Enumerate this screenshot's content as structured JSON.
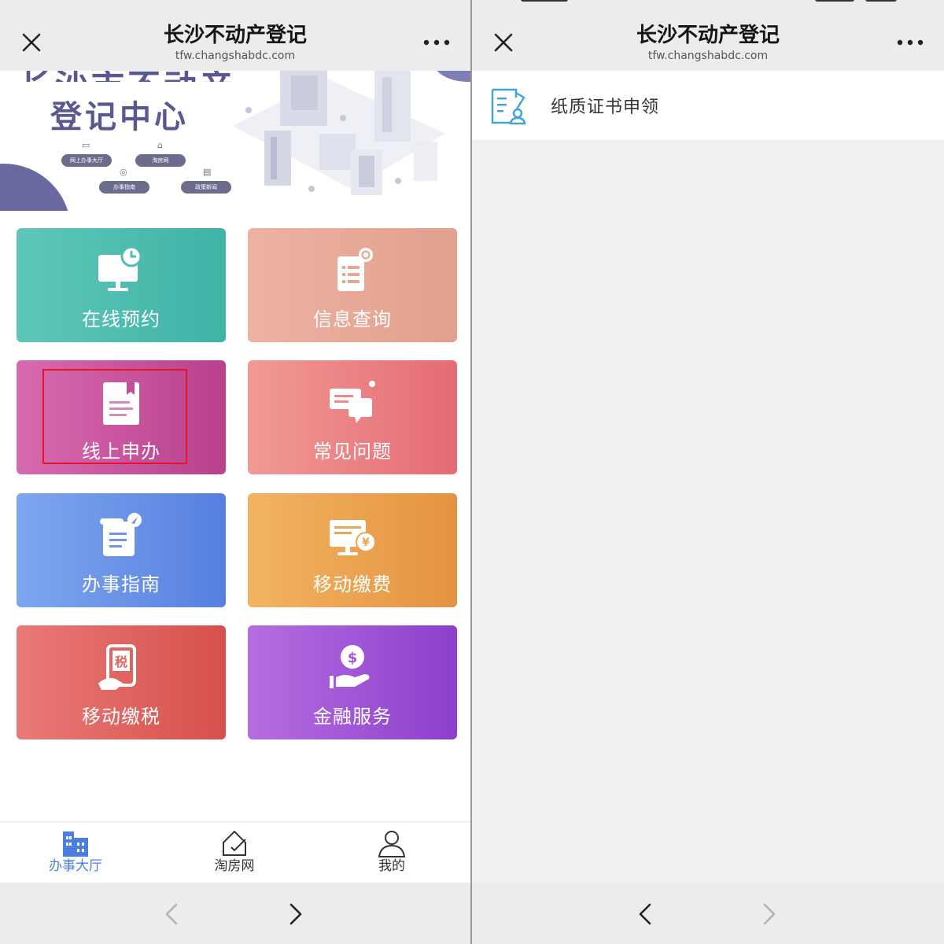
{
  "left": {
    "title": "长沙不动产登记",
    "url": "tfw.changshabdc.com",
    "banner": {
      "heading_top": "长沙市不动产",
      "heading": "登记中心",
      "pills": [
        "网上办事大厅",
        "淘房网",
        "办事指南",
        "政策新闻"
      ]
    },
    "tiles": [
      {
        "label": "在线预约",
        "icon": "monitor-clock-icon",
        "color_from": "#5ec7b9",
        "color_to": "#3fb3a6"
      },
      {
        "label": "信息查询",
        "icon": "document-search-icon",
        "color_from": "#eeb2a0",
        "color_to": "#e2a08f"
      },
      {
        "label": "线上申办",
        "icon": "document-bookmark-icon",
        "color_from": "#d76bb0",
        "color_to": "#b9408c"
      },
      {
        "label": "常见问题",
        "icon": "chat-bubbles-icon",
        "color_from": "#f19a94",
        "color_to": "#e56b76"
      },
      {
        "label": "办事指南",
        "icon": "guide-scroll-icon",
        "color_from": "#7fa6ef",
        "color_to": "#5680e0"
      },
      {
        "label": "移动缴费",
        "icon": "monitor-yen-icon",
        "color_from": "#f2b462",
        "color_to": "#e49340"
      },
      {
        "label": "移动缴税",
        "icon": "phone-tax-icon",
        "color_from": "#ea7a77",
        "color_to": "#d6504b"
      },
      {
        "label": "金融服务",
        "icon": "hand-coin-icon",
        "color_from": "#b56ee0",
        "color_to": "#8c3fcc"
      }
    ],
    "tabs": [
      {
        "label": "办事大厅",
        "icon": "building-icon",
        "active": true
      },
      {
        "label": "淘房网",
        "icon": "house-check-icon",
        "active": false
      },
      {
        "label": "我的",
        "icon": "person-icon",
        "active": false
      }
    ],
    "highlight_color": "#e8132a"
  },
  "right": {
    "title": "长沙不动产登记",
    "url": "tfw.changshabdc.com",
    "list": [
      {
        "label": "纸质证书申领",
        "icon": "certificate-application-icon"
      }
    ]
  },
  "colors": {
    "accent": "#4a7fe0",
    "topbar": "#ececec",
    "banner_text": "#5a5890"
  }
}
